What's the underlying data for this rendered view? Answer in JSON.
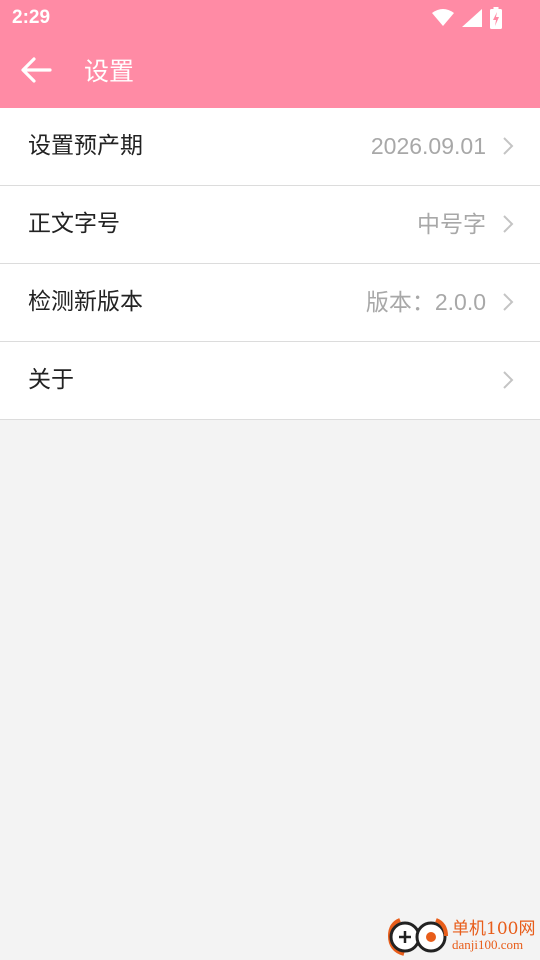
{
  "status_bar": {
    "time": "2:29",
    "icons": [
      "wifi-icon",
      "signal-icon",
      "battery-charging-icon"
    ]
  },
  "app_bar": {
    "title": "设置",
    "back_icon": "arrow-left-icon"
  },
  "settings": {
    "items": [
      {
        "label": "设置预产期",
        "value": "2026.09.01"
      },
      {
        "label": "正文字号",
        "value": "中号字"
      },
      {
        "label": "检测新版本",
        "value": "版本：2.0.0"
      },
      {
        "label": "关于",
        "value": ""
      }
    ]
  },
  "watermark": {
    "main": "单机100网",
    "sub": "danji100.com"
  },
  "colors": {
    "accent": "#ff8ba5",
    "background": "#f3f3f3",
    "value_text": "#a8a8a8",
    "watermark": "#e85d1a"
  }
}
